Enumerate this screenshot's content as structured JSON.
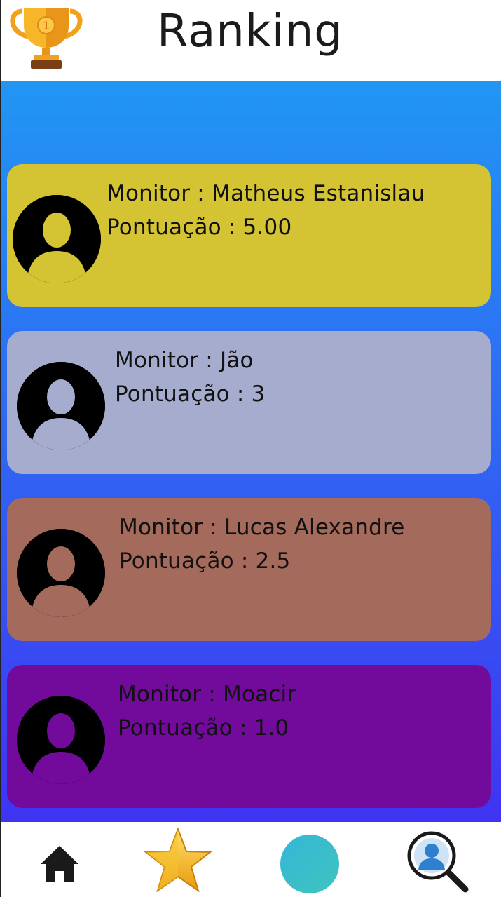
{
  "header": {
    "title": "Ranking"
  },
  "ranking": [
    {
      "monitor_label": "Monitor : Matheus Estanislau",
      "score_label": "Pontuação : 5.00",
      "color": "#d4c333"
    },
    {
      "monitor_label": "Monitor : Jão",
      "score_label": "Pontuação : 3",
      "color": "#a6acce"
    },
    {
      "monitor_label": "Monitor : Lucas Alexandre",
      "score_label": "Pontuação : 2.5",
      "color": "#a46a5c"
    },
    {
      "monitor_label": "Monitor : Moacir",
      "score_label": "Pontuação : 1.0",
      "color": "#720a9c"
    }
  ],
  "nav": {
    "items": [
      {
        "icon": "home-icon"
      },
      {
        "icon": "star-icon"
      },
      {
        "icon": "circle-icon",
        "color": "#3fc4c0"
      },
      {
        "icon": "user-search-icon"
      }
    ]
  },
  "colors": {
    "gradient_top": "#2196f3",
    "gradient_bottom": "#3f34f2"
  }
}
